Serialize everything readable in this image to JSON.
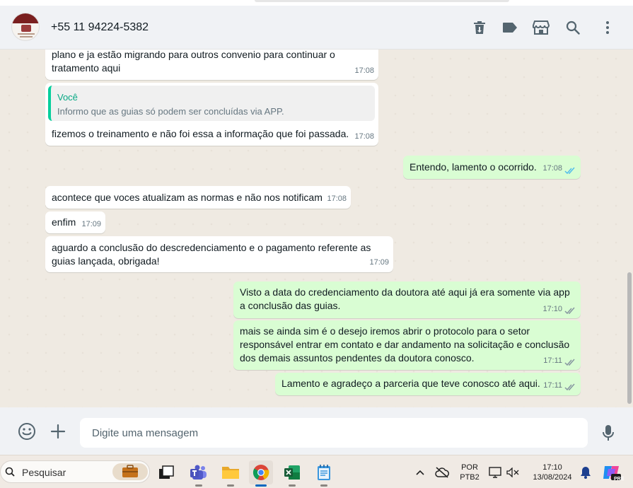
{
  "header": {
    "contact_name": "+55 11 94224-5382"
  },
  "messages": {
    "m1": {
      "text": "plano e ja estão migrando para outros convenio para continuar o tratamento aqui",
      "time": "17:08"
    },
    "m2": {
      "quote_author": "Você",
      "quote_text": "Informo que as guias só podem ser concluídas via APP.",
      "text": "fizemos o treinamento e não foi essa a informação que foi passada.",
      "time": "17:08"
    },
    "m3": {
      "text": "Entendo, lamento o ocorrido.",
      "time": "17:08"
    },
    "m4": {
      "text": "acontece que voces atualizam as normas e não nos notificam",
      "time": "17:08"
    },
    "m5": {
      "text": "enfim",
      "time": "17:09"
    },
    "m6": {
      "text": "aguardo a conclusão do descredenciamento e o pagamento referente as guias lançada, obrigada!",
      "time": "17:09"
    },
    "m7": {
      "text": "Visto a data do credenciamento da doutora até aqui já era somente via app a conclusão das guias.",
      "time": "17:10"
    },
    "m8": {
      "text": "mais se ainda sim é o desejo iremos abrir o protocolo para o setor responsável entrar em contato e dar andamento na solicitação e conclusão dos demais assuntos pendentes da doutora conosco.",
      "time": "17:11"
    },
    "m9": {
      "text": "Lamento e agradeço a parceria que teve conosco até aqui.",
      "time": "17:11"
    }
  },
  "composer": {
    "placeholder": "Digite uma mensagem"
  },
  "taskbar": {
    "search_label": "Pesquisar",
    "lang_top": "POR",
    "lang_bottom": "PTB2",
    "clock_time": "17:10",
    "clock_date": "13/08/2024",
    "copilot_badge": "PRE"
  },
  "colors": {
    "incoming": "#ffffff",
    "outgoing": "#d9fdd3",
    "read_ticks": "#53bdeb",
    "accent": "#06cf9c"
  }
}
